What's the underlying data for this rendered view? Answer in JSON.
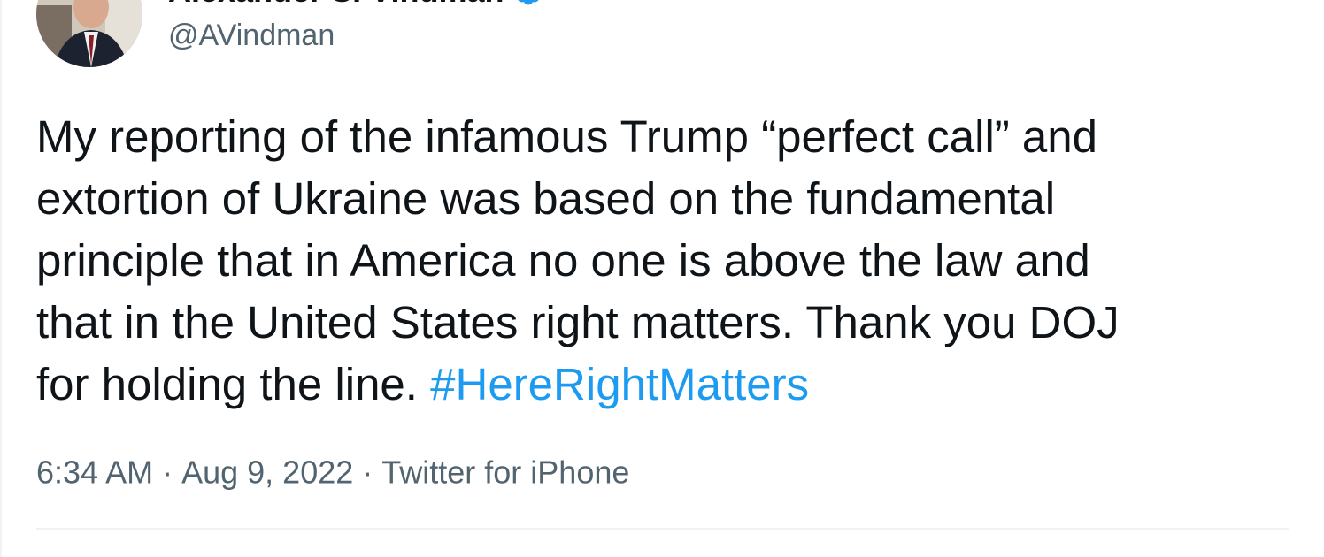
{
  "author": {
    "display_name": "Alexander S. Vindman",
    "handle": "@AVindman",
    "verified": true,
    "verified_badge_color": "#1d9bf0"
  },
  "tweet": {
    "text_lines": [
      "My reporting of the infamous Trump “perfect call” and",
      "extortion of Ukraine was based on the fundamental",
      "principle that in America no one is above the law and",
      "that in the United States right matters. Thank you DOJ",
      "for holding the line. "
    ],
    "hashtag": "#HereRightMatters",
    "hashtag_color": "#1d9bf0"
  },
  "meta": {
    "time": "6:34 AM",
    "separator": " · ",
    "date": "Aug 9, 2022",
    "source": "Twitter for iPhone"
  }
}
